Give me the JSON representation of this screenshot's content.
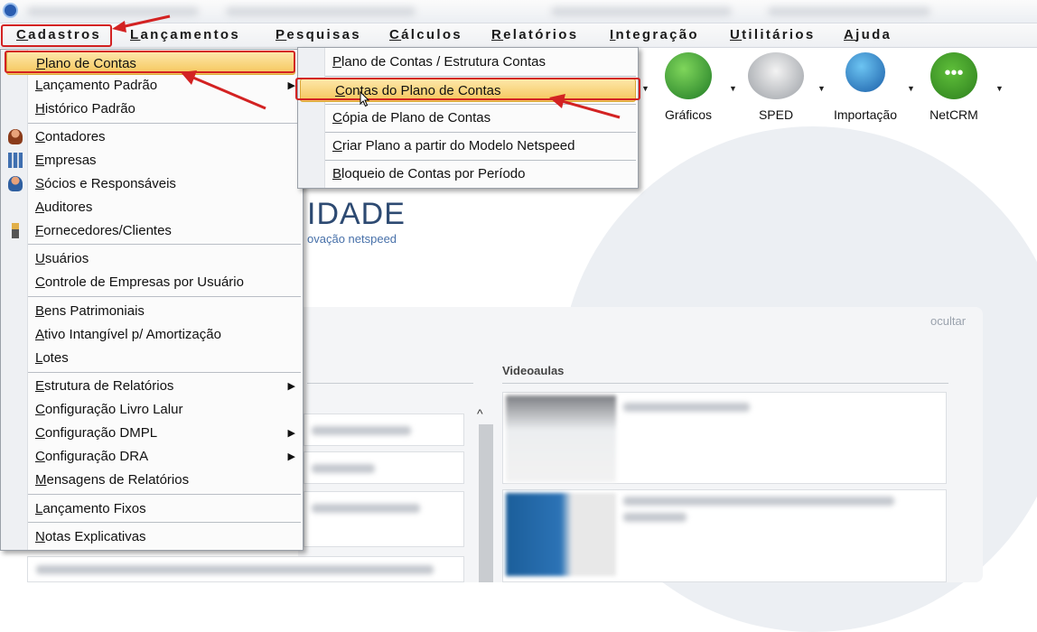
{
  "menubar": {
    "items": [
      "Cadastros",
      "Lançamentos",
      "Pesquisas",
      "Cálculos",
      "Relatórios",
      "Integração",
      "Utilitários",
      "Ajuda"
    ]
  },
  "toolbar": {
    "buttons": [
      {
        "label": "Gráficos",
        "icon": "chart-globe-icon"
      },
      {
        "label": "SPED",
        "icon": "sped-icon"
      },
      {
        "label": "Importação",
        "icon": "import-globe-icon"
      },
      {
        "label": "NetCRM",
        "icon": "chat-bubble-icon"
      }
    ]
  },
  "brand": {
    "name": "IDADE",
    "tagline": "ovação netspeed"
  },
  "panel": {
    "hide_label": "ocultar",
    "videos_heading": "Videoaulas"
  },
  "cadastros_menu": {
    "items": [
      "Plano de Contas",
      "Lançamento Padrão",
      "Histórico Padrão",
      "Contadores",
      "Empresas",
      "Sócios e Responsáveis",
      "Auditores",
      "Fornecedores/Clientes",
      "Usuários",
      "Controle de Empresas por Usuário",
      "Bens Patrimoniais",
      "Ativo Intangível p/ Amortização",
      "Lotes",
      "Estrutura de Relatórios",
      "Configuração Livro Lalur",
      "Configuração DMPL",
      "Configuração DRA",
      "Mensagens de Relatórios",
      "Lançamento Fixos",
      "Notas Explicativas"
    ]
  },
  "plano_submenu": {
    "items": [
      "Plano de Contas / Estrutura Contas",
      "Contas do Plano de Contas",
      "Cópia de Plano de Contas",
      "Criar Plano a partir do Modelo Netspeed",
      "Bloqueio de Contas por Período"
    ]
  },
  "colors": {
    "annotation_red": "#d32222",
    "highlight_gold": "#f5c65a"
  }
}
